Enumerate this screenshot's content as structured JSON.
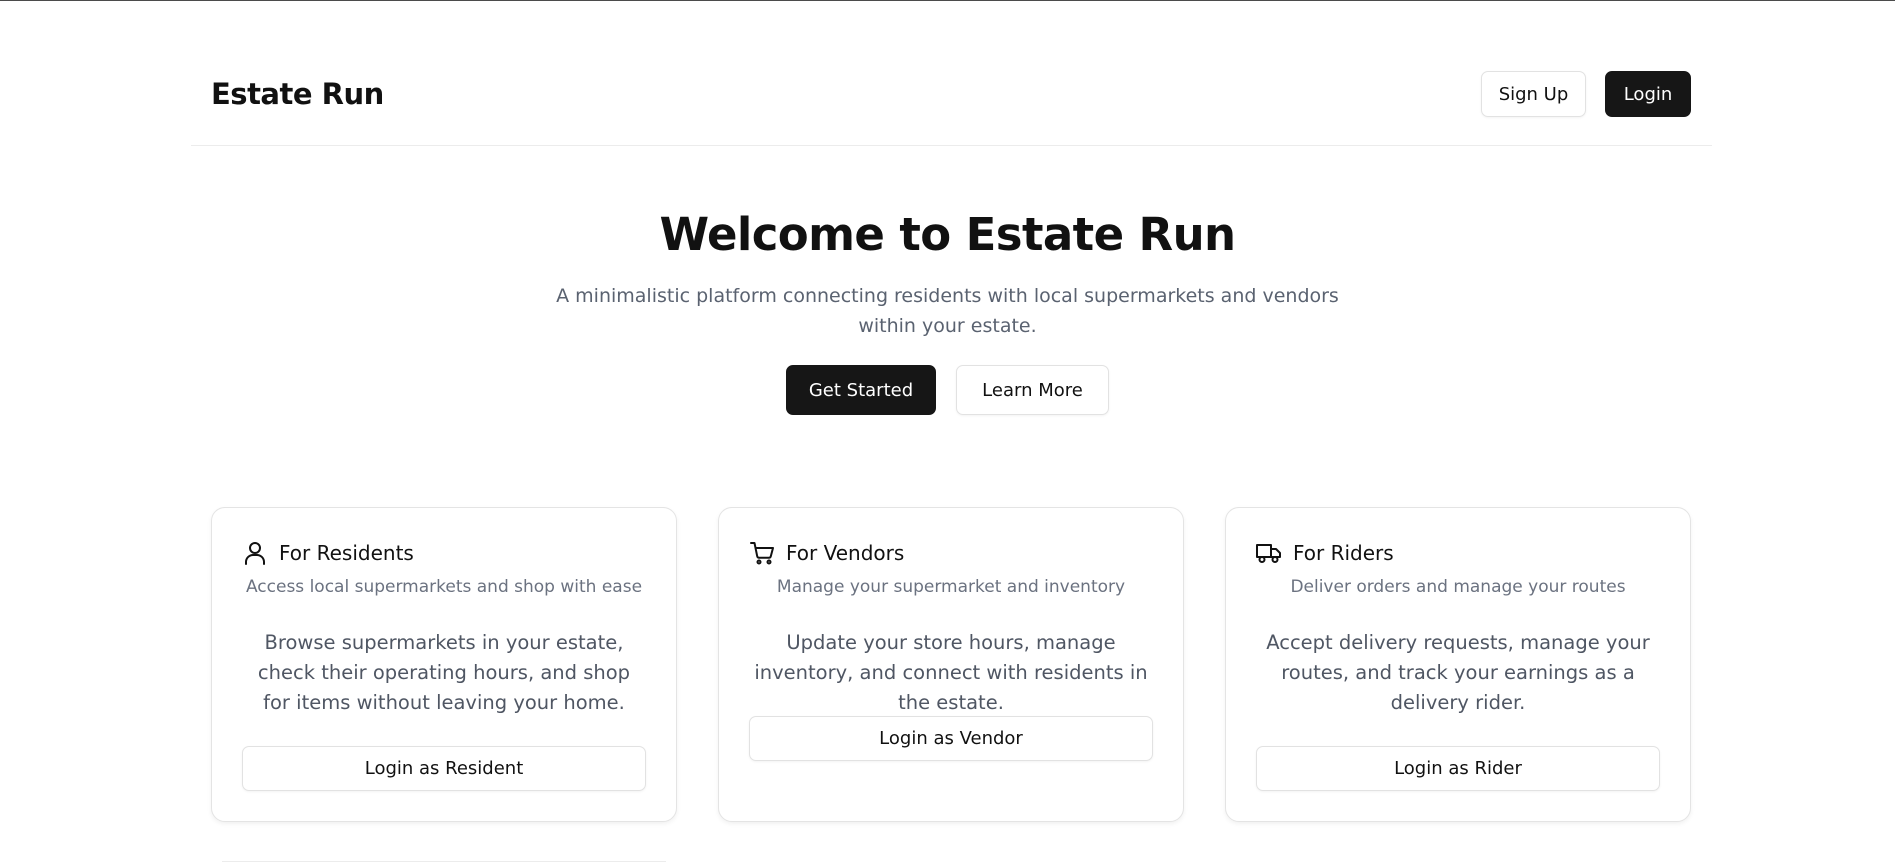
{
  "header": {
    "brand": "Estate Run",
    "signup_label": "Sign Up",
    "login_label": "Login"
  },
  "hero": {
    "title": "Welcome to Estate Run",
    "subtitle": "A minimalistic platform connecting residents with local supermarkets and vendors within your estate.",
    "primary_label": "Get Started",
    "secondary_label": "Learn More"
  },
  "cards": [
    {
      "icon": "user-icon",
      "title": "For Residents",
      "description": "Access local supermarkets and shop with ease",
      "body": "Browse supermarkets in your estate, check their operating hours, and shop for items without leaving your home.",
      "button_label": "Login as Resident"
    },
    {
      "icon": "shopping-cart-icon",
      "title": "For Vendors",
      "description": "Manage your supermarket and inventory",
      "body": "Update your store hours, manage inventory, and connect with residents in the estate.",
      "button_label": "Login as Vendor"
    },
    {
      "icon": "truck-icon",
      "title": "For Riders",
      "description": "Deliver orders and manage your routes",
      "body": "Accept delivery requests, manage your routes, and track your earnings as a delivery rider.",
      "button_label": "Login as Rider"
    }
  ],
  "colors": {
    "primary_dark": "#161616",
    "muted_text": "#6b7280",
    "body_text": "#4f5663",
    "border": "#e4e4e4"
  }
}
